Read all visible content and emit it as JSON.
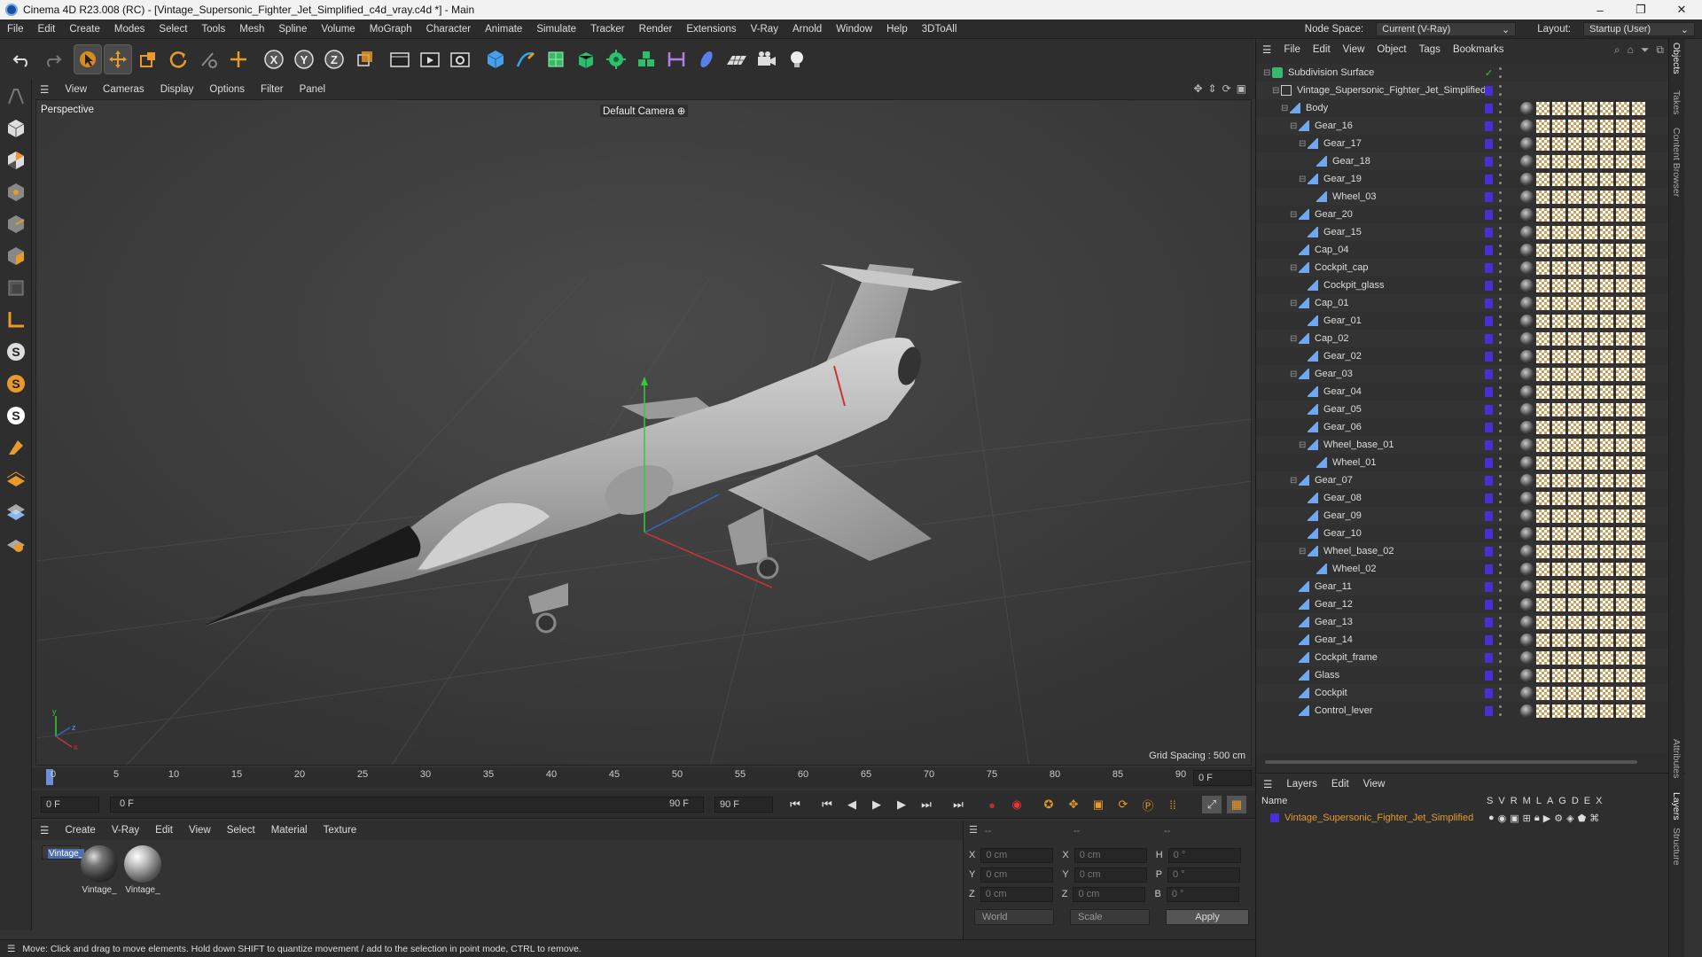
{
  "titlebar": {
    "title": "Cinema 4D R23.008 (RC) - [Vintage_Supersonic_Fighter_Jet_Simplified_c4d_vray.c4d *] - Main",
    "minimize": "–",
    "maximize": "❐",
    "close": "✕"
  },
  "menubar": {
    "items": [
      "File",
      "Edit",
      "Create",
      "Modes",
      "Select",
      "Tools",
      "Mesh",
      "Spline",
      "Volume",
      "MoGraph",
      "Character",
      "Animate",
      "Simulate",
      "Tracker",
      "Render",
      "Extensions",
      "V-Ray",
      "Arnold",
      "Window",
      "Help",
      "3DToAll"
    ],
    "node_space_label": "Node Space:",
    "node_space_value": "Current (V-Ray)",
    "layout_label": "Layout:",
    "layout_value": "Startup (User)"
  },
  "viewport": {
    "menu": [
      "View",
      "Cameras",
      "Display",
      "Options",
      "Filter",
      "Panel"
    ],
    "label": "Perspective",
    "camera": "Default Camera",
    "grid_spacing": "Grid Spacing : 500 cm"
  },
  "timeline": {
    "ticks": [
      "0",
      "5",
      "10",
      "15",
      "20",
      "25",
      "30",
      "35",
      "40",
      "45",
      "50",
      "55",
      "60",
      "65",
      "70",
      "75",
      "80",
      "85",
      "90"
    ],
    "current_frame": "0 F",
    "start_frame": "0 F",
    "range_start": "0 F",
    "range_end": "90 F",
    "end_frame": "90 F"
  },
  "material_manager": {
    "menu": [
      "Create",
      "V-Ray",
      "Edit",
      "View",
      "Select",
      "Material",
      "Texture"
    ],
    "materials": [
      "Vintage_",
      "Vintage_",
      "Vintage_"
    ]
  },
  "coords": {
    "headers": [
      "--",
      "--",
      "--"
    ],
    "rows": [
      {
        "a": "X",
        "av": "0 cm",
        "b": "X",
        "bv": "0 cm",
        "c": "H",
        "cv": "0 °"
      },
      {
        "a": "Y",
        "av": "0 cm",
        "b": "Y",
        "bv": "0 cm",
        "c": "P",
        "cv": "0 °"
      },
      {
        "a": "Z",
        "av": "0 cm",
        "b": "Z",
        "bv": "0 cm",
        "c": "B",
        "cv": "0 °"
      }
    ],
    "world": "World",
    "scale": "Scale",
    "apply": "Apply"
  },
  "status": "Move: Click and drag to move elements. Hold down SHIFT to quantize movement / add to the selection in point mode, CTRL to remove.",
  "object_manager": {
    "menu": [
      "File",
      "Edit",
      "View",
      "Object",
      "Tags",
      "Bookmarks"
    ],
    "objects": [
      {
        "name": "Subdivision Surface",
        "depth": 0
      },
      {
        "name": "Vintage_Supersonic_Fighter_Jet_Simplified",
        "depth": 1
      },
      {
        "name": "Body",
        "depth": 2
      },
      {
        "name": "Gear_16",
        "depth": 3
      },
      {
        "name": "Gear_17",
        "depth": 4
      },
      {
        "name": "Gear_18",
        "depth": 5
      },
      {
        "name": "Gear_19",
        "depth": 4
      },
      {
        "name": "Wheel_03",
        "depth": 5
      },
      {
        "name": "Gear_20",
        "depth": 3
      },
      {
        "name": "Gear_15",
        "depth": 4
      },
      {
        "name": "Cap_04",
        "depth": 3
      },
      {
        "name": "Cockpit_cap",
        "depth": 3
      },
      {
        "name": "Cockpit_glass",
        "depth": 4
      },
      {
        "name": "Cap_01",
        "depth": 3
      },
      {
        "name": "Gear_01",
        "depth": 4
      },
      {
        "name": "Cap_02",
        "depth": 3
      },
      {
        "name": "Gear_02",
        "depth": 4
      },
      {
        "name": "Gear_03",
        "depth": 3
      },
      {
        "name": "Gear_04",
        "depth": 4
      },
      {
        "name": "Gear_05",
        "depth": 4
      },
      {
        "name": "Gear_06",
        "depth": 4
      },
      {
        "name": "Wheel_base_01",
        "depth": 4
      },
      {
        "name": "Wheel_01",
        "depth": 5
      },
      {
        "name": "Gear_07",
        "depth": 3
      },
      {
        "name": "Gear_08",
        "depth": 4
      },
      {
        "name": "Gear_09",
        "depth": 4
      },
      {
        "name": "Gear_10",
        "depth": 4
      },
      {
        "name": "Wheel_base_02",
        "depth": 4
      },
      {
        "name": "Wheel_02",
        "depth": 5
      },
      {
        "name": "Gear_11",
        "depth": 3
      },
      {
        "name": "Gear_12",
        "depth": 3
      },
      {
        "name": "Gear_13",
        "depth": 3
      },
      {
        "name": "Gear_14",
        "depth": 3
      },
      {
        "name": "Cockpit_frame",
        "depth": 3
      },
      {
        "name": "Glass",
        "depth": 3
      },
      {
        "name": "Cockpit",
        "depth": 3
      },
      {
        "name": "Control_lever",
        "depth": 3
      }
    ]
  },
  "layers": {
    "menu": [
      "Layers",
      "Edit",
      "View"
    ],
    "name_header": "Name",
    "cols": [
      "S",
      "V",
      "R",
      "M",
      "L",
      "A",
      "G",
      "D",
      "E",
      "X"
    ],
    "layer_name": "Vintage_Supersonic_Fighter_Jet_Simplified"
  },
  "side_tabs": [
    "Objects",
    "Takes",
    "Content Browser",
    "Attributes",
    "Layers",
    "Structure"
  ],
  "colors": {
    "accent": "#4a2fd6",
    "layer_text": "#e69a2e",
    "selected": "#4c6fb0"
  }
}
